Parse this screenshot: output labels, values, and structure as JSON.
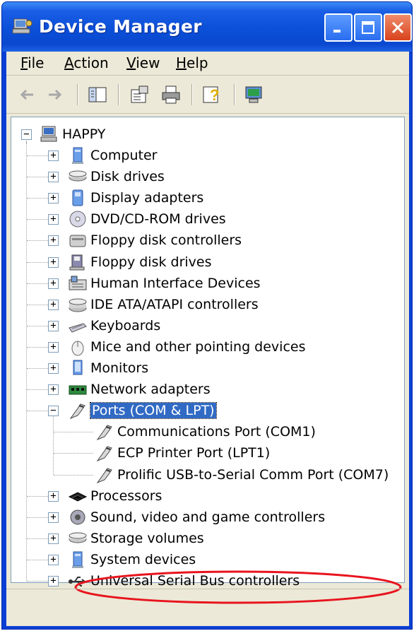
{
  "window": {
    "title": "Device Manager",
    "title_icon": "device-manager-icon"
  },
  "titlebar_buttons": [
    "minimize-icon",
    "maximize-icon",
    "close-icon"
  ],
  "menu": [
    {
      "label": "File",
      "hotkey": "F",
      "rest": "ile"
    },
    {
      "label": "Action",
      "hotkey": "A",
      "rest": "ction"
    },
    {
      "label": "View",
      "hotkey": "V",
      "rest": "iew"
    },
    {
      "label": "Help",
      "hotkey": "H",
      "rest": "elp"
    }
  ],
  "toolbar_icons": [
    "back-arrow-icon",
    "forward-arrow-icon",
    "show-hide-tree-icon",
    "properties-icon",
    "print-icon",
    "help-icon",
    "scan-hardware-icon"
  ],
  "tree": {
    "root": "HAPPY",
    "categories": [
      {
        "label": "Computer",
        "icon": "computer-icon",
        "expanded": false
      },
      {
        "label": "Disk drives",
        "icon": "disk-drive-icon",
        "expanded": false
      },
      {
        "label": "Display adapters",
        "icon": "display-adapter-icon",
        "expanded": false
      },
      {
        "label": "DVD/CD-ROM drives",
        "icon": "cdrom-icon",
        "expanded": false
      },
      {
        "label": "Floppy disk controllers",
        "icon": "floppy-controller-icon",
        "expanded": false
      },
      {
        "label": "Floppy disk drives",
        "icon": "floppy-drive-icon",
        "expanded": false
      },
      {
        "label": "Human Interface Devices",
        "icon": "hid-icon",
        "expanded": false
      },
      {
        "label": "IDE ATA/ATAPI controllers",
        "icon": "ide-controller-icon",
        "expanded": false
      },
      {
        "label": "Keyboards",
        "icon": "keyboard-icon",
        "expanded": false
      },
      {
        "label": "Mice and other pointing devices",
        "icon": "mouse-icon",
        "expanded": false
      },
      {
        "label": "Monitors",
        "icon": "monitor-icon",
        "expanded": false
      },
      {
        "label": "Network adapters",
        "icon": "network-adapter-icon",
        "expanded": false
      },
      {
        "label": "Ports (COM & LPT)",
        "icon": "port-icon",
        "expanded": true,
        "selected": true,
        "children": [
          {
            "label": "Communications Port (COM1)",
            "icon": "port-icon"
          },
          {
            "label": "ECP Printer Port (LPT1)",
            "icon": "port-icon"
          },
          {
            "label": "Prolific USB-to-Serial Comm Port (COM7)",
            "icon": "port-icon",
            "highlighted": true
          }
        ]
      },
      {
        "label": "Processors",
        "icon": "processor-icon",
        "expanded": false
      },
      {
        "label": "Sound, video and game controllers",
        "icon": "sound-icon",
        "expanded": false
      },
      {
        "label": "Storage volumes",
        "icon": "storage-volume-icon",
        "expanded": false
      },
      {
        "label": "System devices",
        "icon": "system-device-icon",
        "expanded": false
      },
      {
        "label": "Universal Serial Bus controllers",
        "icon": "usb-icon",
        "expanded": false
      }
    ]
  },
  "colors": {
    "selection": "#316ac5",
    "annotation": "#e8141e",
    "titlebar": "#0b4fd8"
  }
}
